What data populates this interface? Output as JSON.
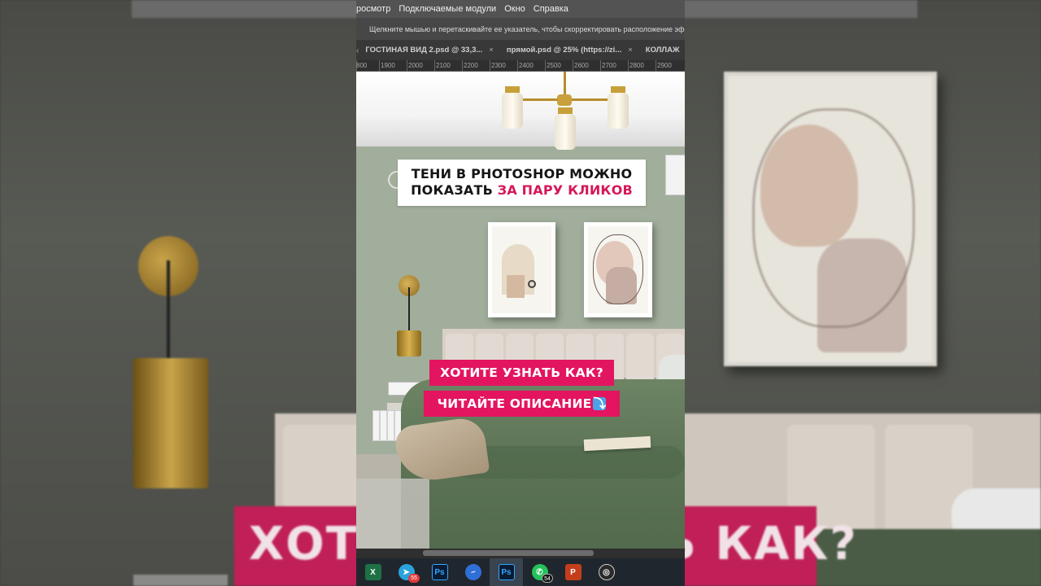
{
  "menubar": {
    "items": [
      "росмотр",
      "Подключаемые модули",
      "Окно",
      "Справка"
    ]
  },
  "options_bar": {
    "hint": "Щелкните мышью и перетаскивайте ее указатель, чтобы скорректировать расположение эффекта"
  },
  "tabs": [
    {
      "label": "ГОСТИНАЯ ВИД 2.psd @ 33,3..."
    },
    {
      "label": "прямой.psd @ 25% (https://zi..."
    },
    {
      "label": "КОЛЛАЖ"
    }
  ],
  "ruler": {
    "ticks": [
      "800",
      "1900",
      "2000",
      "2100",
      "2200",
      "2300",
      "2400",
      "2500",
      "2600",
      "2700",
      "2800",
      "2900"
    ]
  },
  "canvas": {
    "title_line1": "ТЕНИ В PHOTOSHOP МОЖНО",
    "title_line2_plain": "ПОКАЗАТЬ ",
    "title_line2_accent": "ЗА ПАРУ КЛИКОВ",
    "banner1": "ХОТИТЕ УЗНАТЬ КАК?",
    "banner2": "ЧИТАЙТЕ ОПИСАНИЕ",
    "banner2_emoji": "⤵"
  },
  "background": {
    "banner_text": "ХОТИТЕ УЗНАТЬ КАК?"
  },
  "taskbar": {
    "apps": [
      {
        "name": "excel",
        "glyph": "X",
        "color": "#1e7145",
        "badge": ""
      },
      {
        "name": "telegram",
        "glyph": "➤",
        "color": "#2aa3dc",
        "badge": "55"
      },
      {
        "name": "photoshop-1",
        "glyph": "Ps",
        "color": "#0b1b33",
        "badge": ""
      },
      {
        "name": "zoom-app",
        "glyph": "~",
        "color": "#2f6fd6",
        "badge": ""
      },
      {
        "name": "photoshop-2",
        "glyph": "Ps",
        "color": "#0b1b33",
        "badge": ""
      },
      {
        "name": "whatsapp",
        "glyph": "✆",
        "color": "#25c25a",
        "badge": "54"
      },
      {
        "name": "powerpoint",
        "glyph": "P",
        "color": "#c43e1c",
        "badge": ""
      },
      {
        "name": "obs",
        "glyph": "◎",
        "color": "#2a2a2a",
        "badge": ""
      }
    ]
  },
  "colors": {
    "accent_pink": "#e31460",
    "title_accent": "#d6175a",
    "wall_green": "#a2ae9c",
    "bed_green": "#5d7556"
  }
}
